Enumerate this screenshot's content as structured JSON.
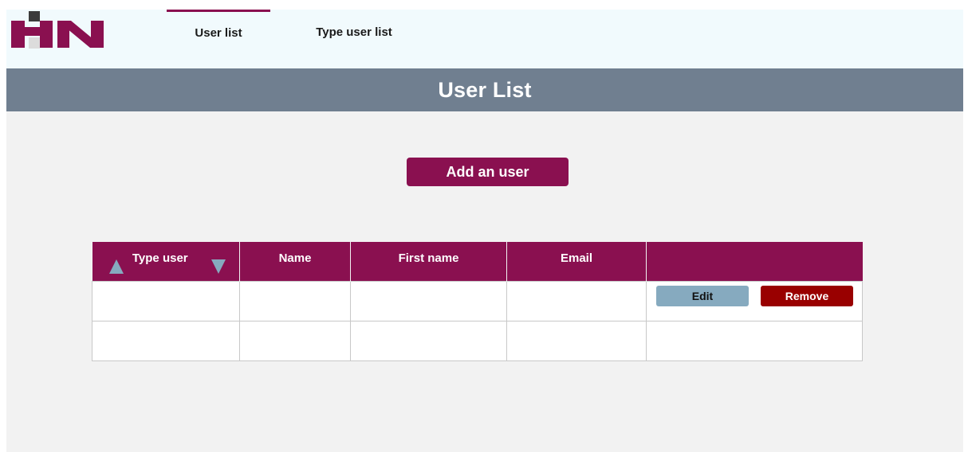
{
  "nav": {
    "tabs": [
      {
        "label": "User list",
        "active": true
      },
      {
        "label": "Type user list",
        "active": false
      }
    ]
  },
  "page": {
    "title": "User List",
    "add_button_label": "Add an user"
  },
  "table": {
    "columns": [
      "Type user",
      "Name",
      "First name",
      "Email",
      ""
    ],
    "rows": [
      {
        "type_user": "",
        "name": "",
        "first_name": "",
        "email": "",
        "actions": {
          "edit_label": "Edit",
          "remove_label": "Remove"
        }
      },
      {
        "type_user": "",
        "name": "",
        "first_name": "",
        "email": ""
      }
    ]
  },
  "colors": {
    "brand": "#8a1050",
    "logo_gray": "#3b3b3b",
    "logo_light": "#dcdcdc",
    "title_band": "#707f90",
    "edit_button": "#86aabf",
    "remove_button": "#990000",
    "topbar_bg": "#f1fafd",
    "page_bg": "#f2f2f2"
  },
  "icons": {
    "sort_asc": "triangle-up-icon",
    "sort_desc": "triangle-down-icon"
  }
}
